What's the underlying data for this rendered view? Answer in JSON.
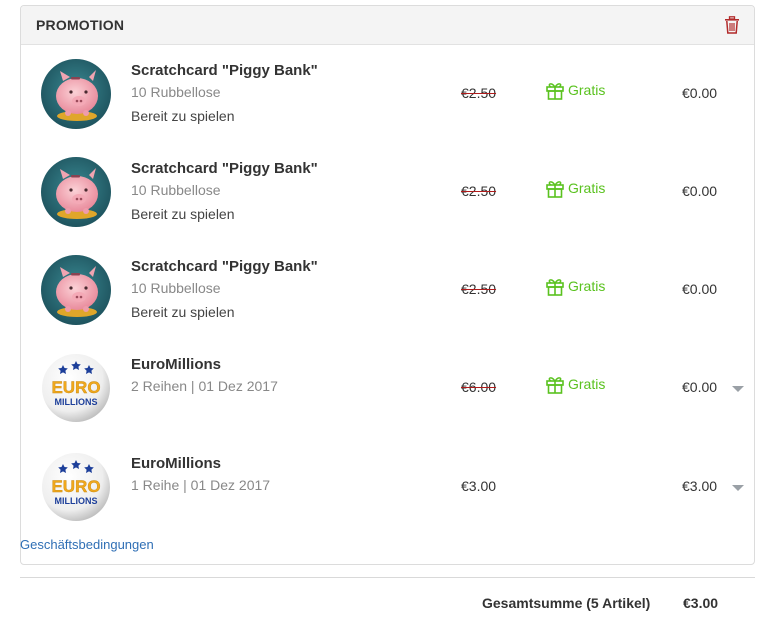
{
  "panel": {
    "title": "PROMOTION",
    "delete_icon": "trash-icon",
    "accent_delete": "#b22a2a"
  },
  "items": [
    {
      "name": "Scratchcard \"Piggy Bank\"",
      "sub": "10 Rubbellose",
      "status": "Bereit zu spielen",
      "old_price": "€2.50",
      "gratis": "Gratis",
      "final_price": "€0.00",
      "logo": "piggy-bank-logo",
      "has_chevron": false
    },
    {
      "name": "Scratchcard \"Piggy Bank\"",
      "sub": "10 Rubbellose",
      "status": "Bereit zu spielen",
      "old_price": "€2.50",
      "gratis": "Gratis",
      "final_price": "€0.00",
      "logo": "piggy-bank-logo",
      "has_chevron": false
    },
    {
      "name": "Scratchcard \"Piggy Bank\"",
      "sub": "10 Rubbellose",
      "status": "Bereit zu spielen",
      "old_price": "€2.50",
      "gratis": "Gratis",
      "final_price": "€0.00",
      "logo": "piggy-bank-logo",
      "has_chevron": false
    },
    {
      "name": "EuroMillions",
      "sub": "2 Reihen | 01 Dez 2017",
      "old_price": "€6.00",
      "gratis": "Gratis",
      "final_price": "€0.00",
      "logo": "euromillions-logo",
      "has_chevron": true
    },
    {
      "name": "EuroMillions",
      "sub": "1 Reihe | 01 Dez 2017",
      "price": "€3.00",
      "final_price": "€3.00",
      "logo": "euromillions-logo",
      "has_chevron": true
    }
  ],
  "euromillions_logo_text": {
    "line1": "EURO",
    "line2": "MILLIONS"
  },
  "terms_link": "Geschäftsbedingungen",
  "summary": {
    "label": "Gesamtsumme (5 Artikel)",
    "total": "€3.00"
  },
  "colors": {
    "gratis_green": "#5ac21f",
    "link_blue": "#2f6fb5",
    "strike_red": "#b01b1b"
  }
}
